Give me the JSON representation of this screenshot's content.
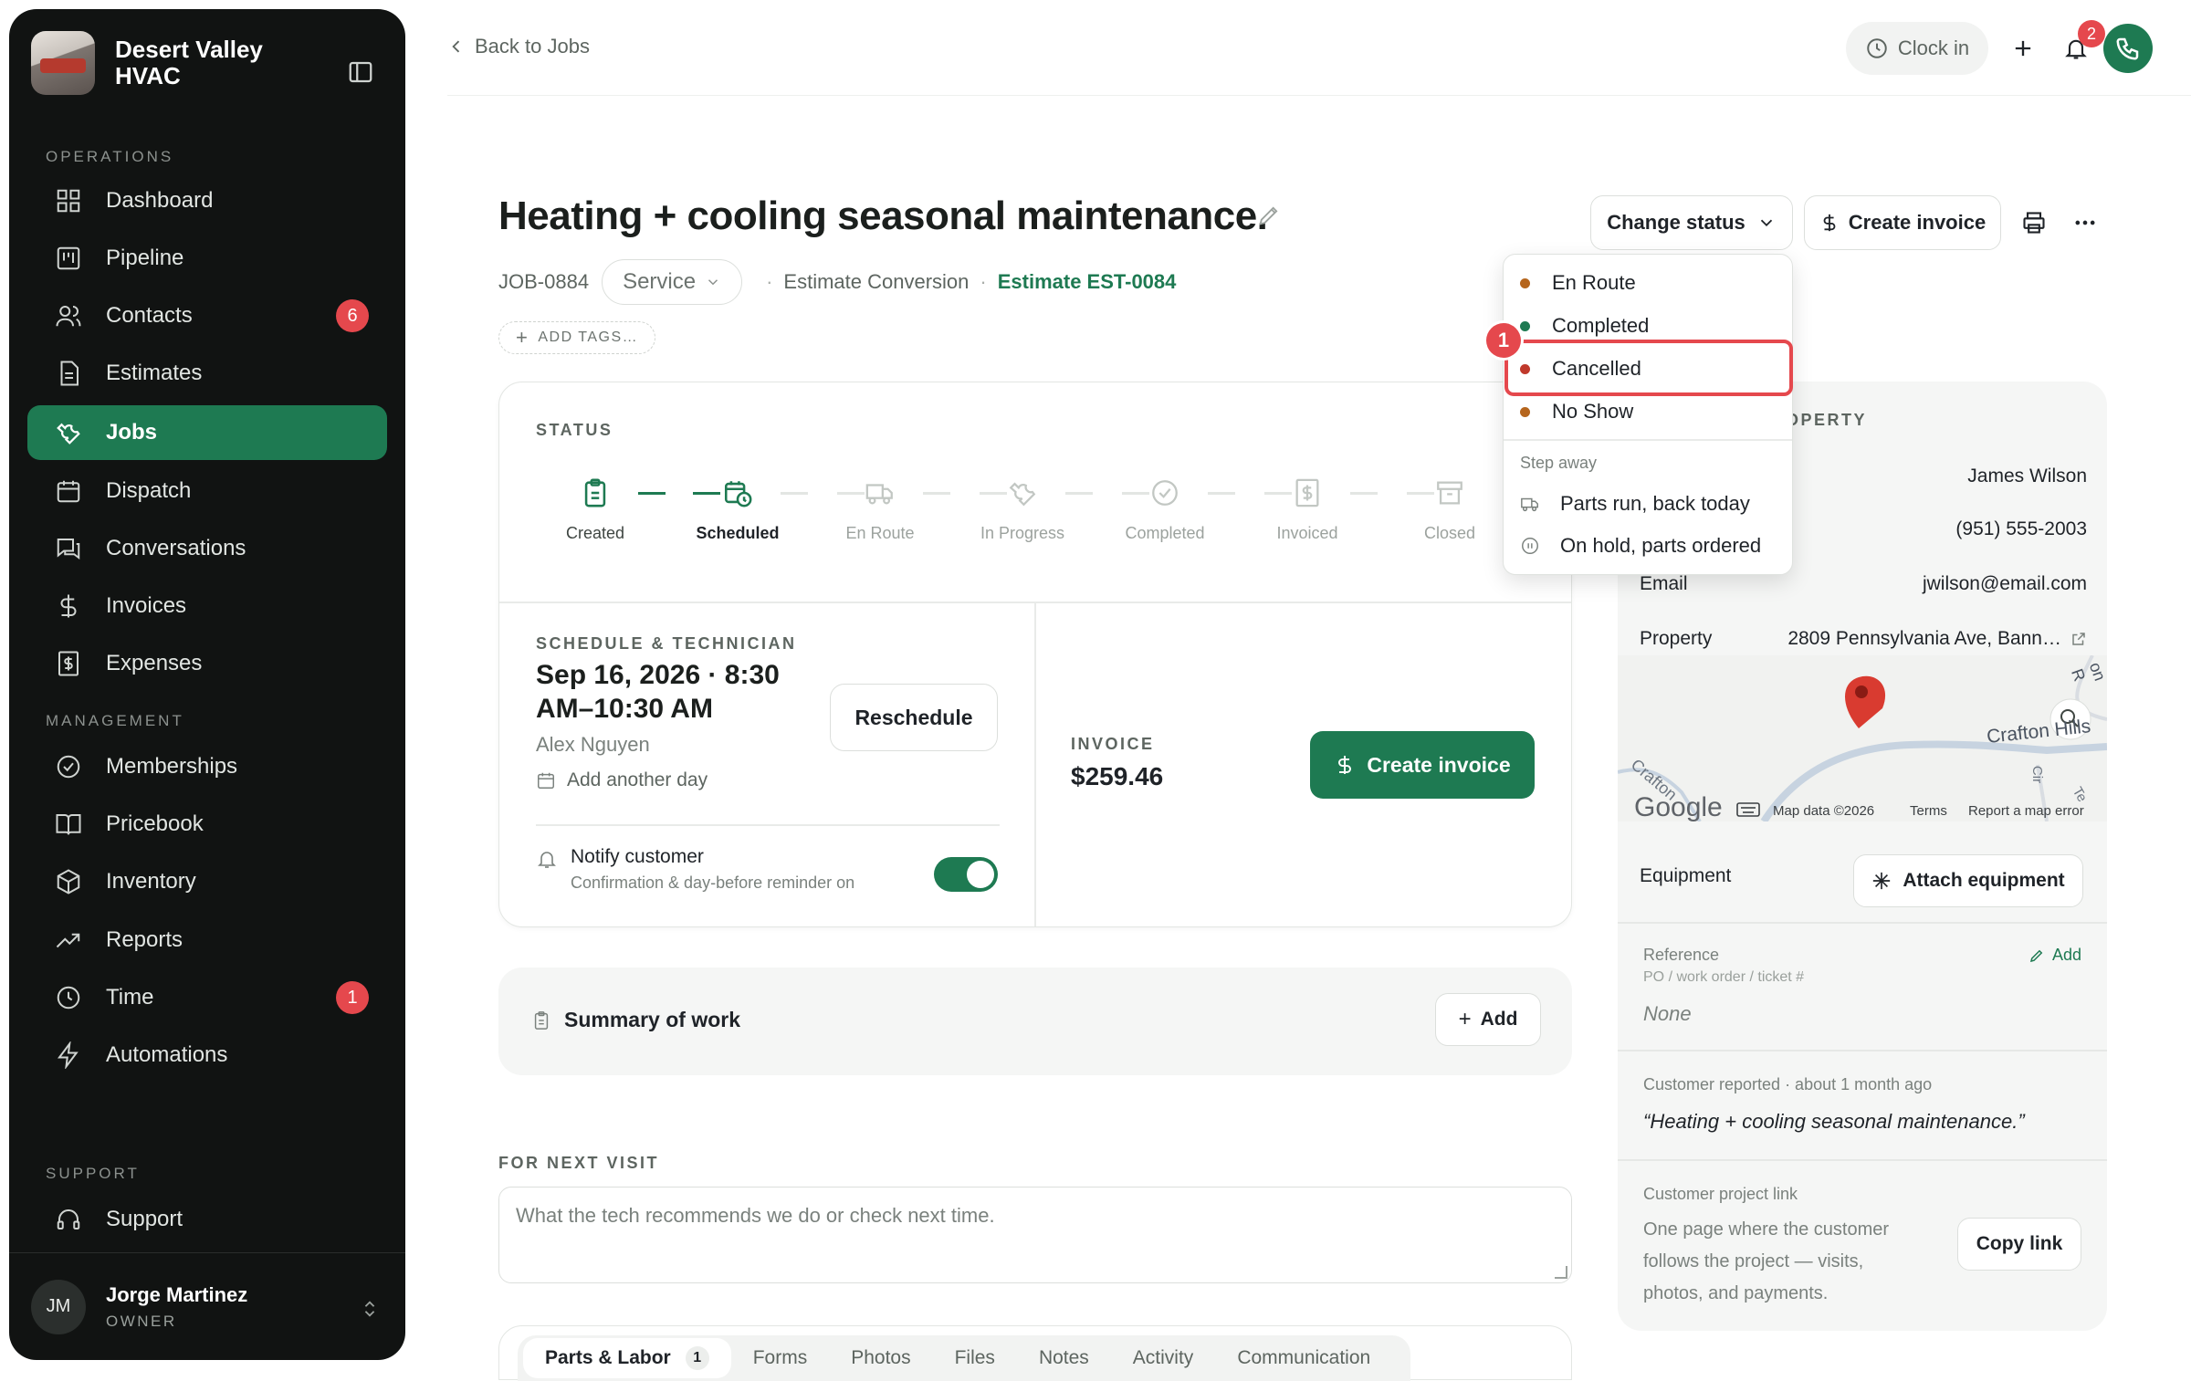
{
  "colors": {
    "accent": "#1e7a52",
    "danger": "#e5484d",
    "orange": "#b5651d",
    "sidebar": "#111312"
  },
  "brand": {
    "name": "Desert Valley HVAC"
  },
  "sidebar": {
    "sections": [
      "OPERATIONS",
      "MANAGEMENT",
      "SUPPORT"
    ],
    "operations": [
      {
        "label": "Dashboard",
        "icon": "dashboard-icon"
      },
      {
        "label": "Pipeline",
        "icon": "pipeline-icon"
      },
      {
        "label": "Contacts",
        "icon": "contacts-icon",
        "badge": "6"
      },
      {
        "label": "Estimates",
        "icon": "estimates-icon"
      },
      {
        "label": "Jobs",
        "icon": "wrench-icon",
        "active": true
      },
      {
        "label": "Dispatch",
        "icon": "calendar-icon"
      },
      {
        "label": "Conversations",
        "icon": "chat-icon"
      },
      {
        "label": "Invoices",
        "icon": "dollar-icon"
      },
      {
        "label": "Expenses",
        "icon": "receipt-icon"
      }
    ],
    "management": [
      {
        "label": "Memberships",
        "icon": "check-circle-icon"
      },
      {
        "label": "Pricebook",
        "icon": "book-icon"
      },
      {
        "label": "Inventory",
        "icon": "box-icon"
      },
      {
        "label": "Reports",
        "icon": "trend-icon"
      },
      {
        "label": "Time",
        "icon": "clock-icon",
        "badge": "1"
      },
      {
        "label": "Automations",
        "icon": "bolt-icon"
      }
    ],
    "support": [
      {
        "label": "Support",
        "icon": "headset-icon"
      }
    ],
    "user": {
      "initials": "JM",
      "name": "Jorge Martinez",
      "role": "OWNER"
    }
  },
  "topbar": {
    "back": "Back to Jobs",
    "clock_in": "Clock in",
    "notif_count": "2"
  },
  "job": {
    "title": "Heating + cooling seasonal maintenance.",
    "id": "JOB-0884",
    "type": "Service",
    "source": "Estimate Conversion",
    "estimate": "Estimate EST-0084",
    "add_tags": "ADD TAGS…",
    "change_status": "Change status",
    "create_invoice": "Create invoice"
  },
  "status": {
    "caption": "STATUS",
    "steps": [
      "Created",
      "Scheduled",
      "En Route",
      "In Progress",
      "Completed",
      "Invoiced",
      "Closed"
    ]
  },
  "schedule": {
    "caption": "SCHEDULE & TECHNICIAN",
    "date": "Sep 16, 2026 · 8:30 AM–10:30 AM",
    "tech": "Alex Nguyen",
    "add_day": "Add another day",
    "reschedule": "Reschedule",
    "notify_title": "Notify customer",
    "notify_sub": "Confirmation & day-before reminder on",
    "notify_on": true
  },
  "invoice": {
    "caption": "INVOICE",
    "amount": "$259.46",
    "button": "Create invoice"
  },
  "summary": {
    "title": "Summary of work",
    "add": "Add"
  },
  "next_visit": {
    "caption": "FOR NEXT VISIT",
    "placeholder": "What the tech recommends we do or check next time."
  },
  "tabs": [
    {
      "label": "Parts & Labor",
      "count": "1"
    },
    {
      "label": "Forms"
    },
    {
      "label": "Photos"
    },
    {
      "label": "Files"
    },
    {
      "label": "Notes"
    },
    {
      "label": "Activity"
    },
    {
      "label": "Communication"
    }
  ],
  "customer": {
    "caption": "OPERTY",
    "name": "James Wilson",
    "phone": "(951) 555-2003",
    "email_label": "Email",
    "email": "jwilson@email.com",
    "property_label": "Property",
    "property": "2809 Pennsylvania Ave, Bann…"
  },
  "map": {
    "labels": [
      "Crafton Hills",
      "Crafton",
      "Google",
      "Map data ©2026",
      "Terms",
      "Report a map error",
      "on R",
      "Cir",
      "Te"
    ]
  },
  "equipment": {
    "label": "Equipment",
    "button": "Attach equipment"
  },
  "reference": {
    "label": "Reference",
    "sub": "PO / work order / ticket #",
    "value": "None",
    "add": "Add"
  },
  "reported": {
    "label": "Customer reported · about 1 month ago",
    "quote": "“Heating + cooling seasonal maintenance.”"
  },
  "project_link": {
    "label": "Customer project link",
    "desc": "One page where the customer follows the project — visits, photos, and payments.",
    "button": "Copy link"
  },
  "dropdown": {
    "items": [
      {
        "label": "En Route",
        "color": "#b5651d"
      },
      {
        "label": "Completed",
        "color": "#1e7a52"
      },
      {
        "label": "Cancelled",
        "color": "#c0392b"
      },
      {
        "label": "No Show",
        "color": "#b5651d"
      }
    ],
    "step_away": "Step away",
    "away_items": [
      {
        "label": "Parts run, back today",
        "icon": "truck-icon"
      },
      {
        "label": "On hold, parts ordered",
        "icon": "pause-icon"
      }
    ],
    "marker": "1"
  }
}
